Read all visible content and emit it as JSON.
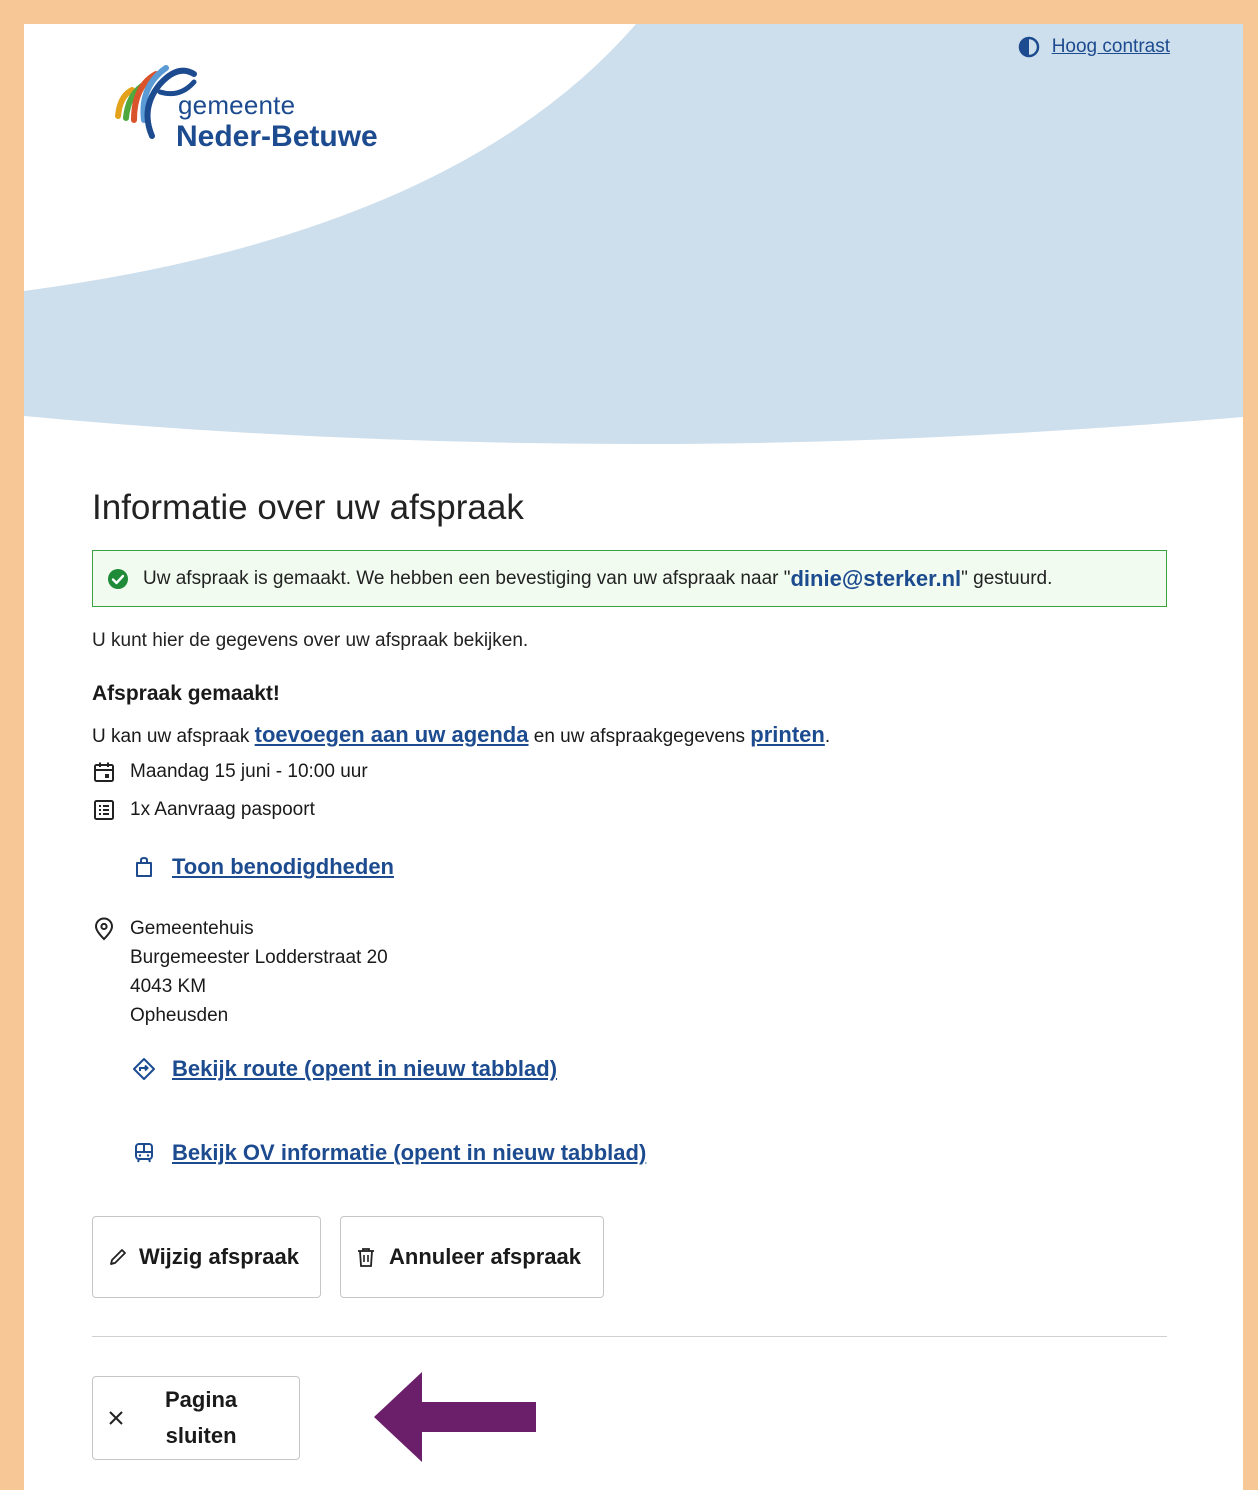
{
  "header": {
    "brand_line1": "gemeente",
    "brand_line2": "Neder-Betuwe",
    "contrast_label": "Hoog contrast"
  },
  "main": {
    "title": "Informatie over uw afspraak",
    "alert": {
      "prefix": "Uw afspraak is gemaakt. We hebben een bevestiging van uw afspraak naar \"",
      "email": "dinie@sterker.nl",
      "suffix": "\" gestuurd."
    },
    "intro": "U kunt hier de gegevens over uw afspraak bekijken.",
    "subtitle": "Afspraak gemaakt!",
    "agenda_text_1": "U kan uw afspraak ",
    "agenda_link": "toevoegen aan uw agenda",
    "agenda_text_2": " en uw afspraakgegevens ",
    "print_link": "printen",
    "agenda_text_3": ".",
    "date": "Maandag 15 juni - 10:00 uur",
    "product": "1x Aanvraag paspoort",
    "requirements_link": "Toon benodigdheden",
    "location": {
      "name": "Gemeentehuis",
      "street": "Burgemeester Lodderstraat 20",
      "postal": "4043 KM",
      "city": "Opheusden"
    },
    "route_link": "Bekijk route (opent in nieuw tabblad)",
    "ov_link": "Bekijk OV informatie (opent in nieuw tabblad)"
  },
  "actions": {
    "edit_label": "Wijzig afspraak",
    "cancel_label": "Annuleer afspraak",
    "close_label_1": "Pagina",
    "close_label_2": "sluiten"
  },
  "colors": {
    "brand_blue": "#1d4b8f",
    "success_green": "#3aa23e",
    "annotation_arrow": "#6b1f6b",
    "frame": "#f7c896"
  },
  "icons": [
    "contrast-icon",
    "check-circle-icon",
    "calendar-icon",
    "list-icon",
    "bag-icon",
    "map-pin-icon",
    "route-icon",
    "bus-icon",
    "pencil-icon",
    "trash-icon",
    "close-icon",
    "arrow-left-icon"
  ]
}
